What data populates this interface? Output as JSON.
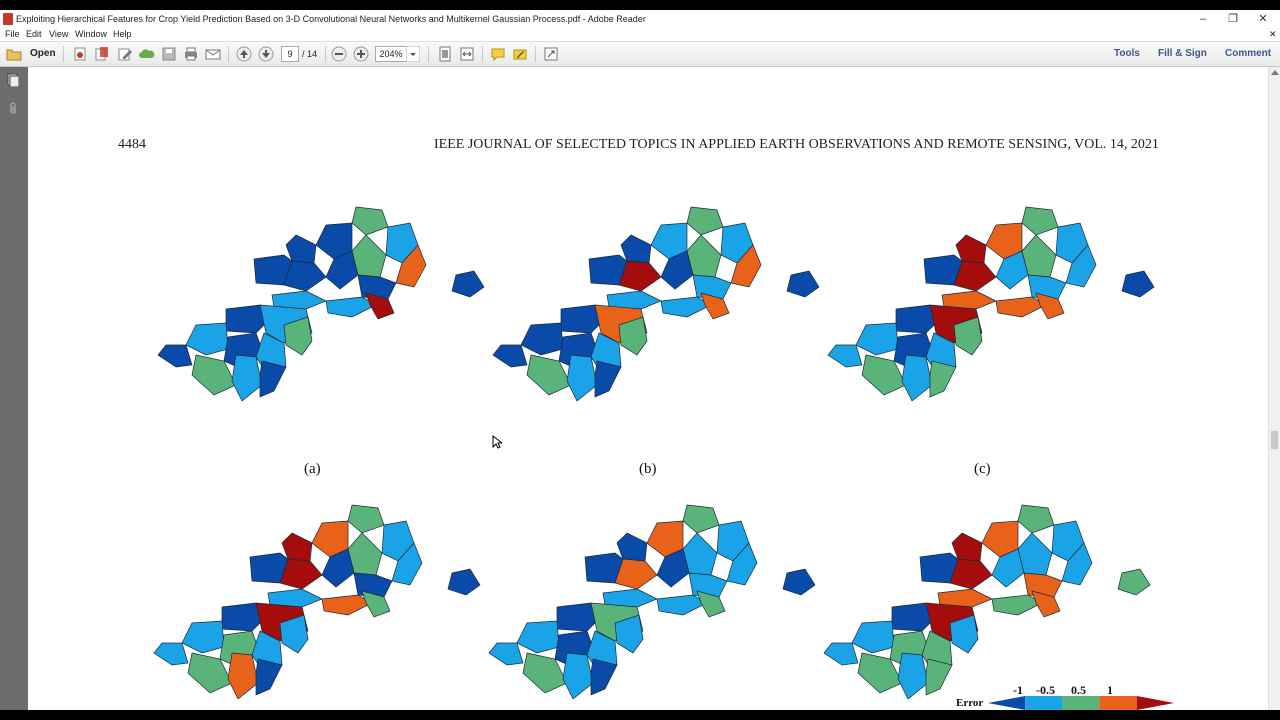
{
  "window": {
    "title": "Exploiting Hierarchical Features for Crop Yield Prediction Based on 3-D Convolutional Neural Networks and Multikernel Gaussian Process.pdf - Adobe Reader",
    "minimize": "–",
    "restore": "❐",
    "close": "✕",
    "doc_close": "✕"
  },
  "menu": [
    "File",
    "Edit",
    "View",
    "Window",
    "Help"
  ],
  "toolbar": {
    "open_label": "Open",
    "page_current": "9",
    "page_total": "/ 14",
    "zoom": "204%",
    "tools_label": "Tools",
    "fill_sign_label": "Fill & Sign",
    "comment_label": "Comment"
  },
  "page": {
    "number": "4484",
    "journal": "IEEE JOURNAL OF SELECTED TOPICS IN APPLIED EARTH OBSERVATIONS AND REMOTE SENSING, VOL. 14, 2021",
    "captions": [
      "(a)",
      "(b)",
      "(c)"
    ]
  },
  "legend": {
    "label": "Error",
    "ticks": [
      "-1",
      "-0.5",
      "0.5",
      "1"
    ],
    "colors": [
      "#0a4aa8",
      "#1aa3e6",
      "#5ab47a",
      "#e8621a",
      "#a50d0d"
    ]
  }
}
